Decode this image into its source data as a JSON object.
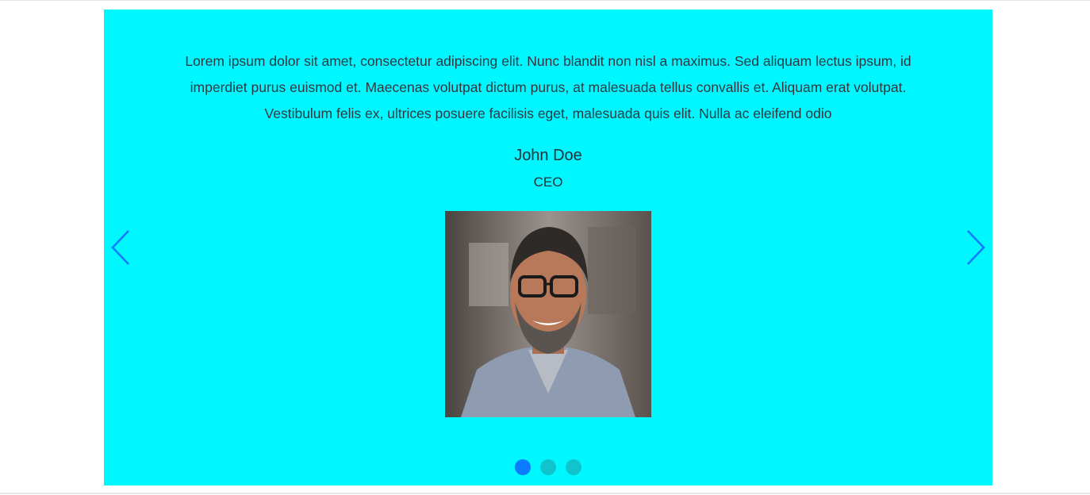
{
  "testimonial": {
    "quote": "Lorem ipsum dolor sit amet, consectetur adipiscing elit. Nunc blandit non nisl a maximus. Sed aliquam lectus ipsum, id imperdiet purus euismod et. Maecenas volutpat dictum purus, at malesuada tellus convallis et. Aliquam erat volutpat. Vestibulum felis ex, ultrices posuere facilisis eget, malesuada quis elit. Nulla ac eleifend odio",
    "name": "John Doe",
    "title": "CEO"
  },
  "carousel": {
    "prev_icon": "chevron-left-icon",
    "next_icon": "chevron-right-icon",
    "slide_count": 3,
    "active_index": 0
  },
  "colors": {
    "background": "#00f7ff",
    "arrow": "#0d7bff",
    "dot_active": "#0d7bff",
    "dot_inactive": "#11c3cc"
  }
}
